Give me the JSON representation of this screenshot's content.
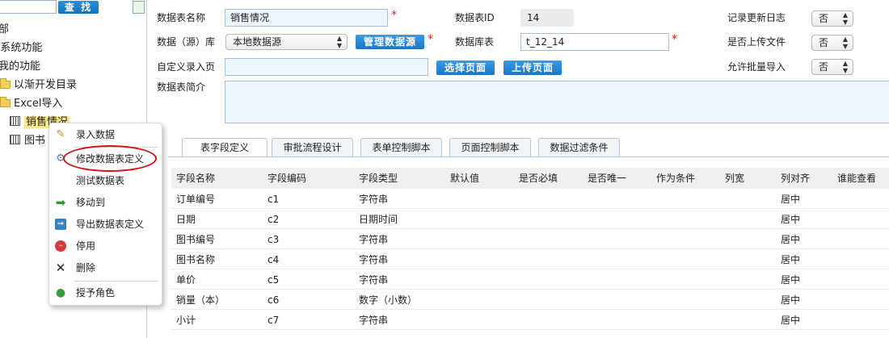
{
  "sidebar": {
    "search_placeholder": "",
    "search_button": "查 找",
    "nodes": [
      "部",
      "/系统功能",
      "我的功能",
      "以渐开发目录",
      "Excel导入",
      "销售情况",
      "图书"
    ]
  },
  "context_menu": {
    "items": [
      "录入数据",
      "修改数据表定义",
      "测试数据表",
      "移动到",
      "导出数据表定义",
      "停用",
      "删除",
      "授予角色"
    ]
  },
  "form": {
    "table_name_label": "数据表名称",
    "table_name_value": "销售情况",
    "table_id_label": "数据表ID",
    "table_id_value": "14",
    "log_label": "记录更新日志",
    "log_value": "否",
    "datasource_label": "数据（源）库",
    "datasource_value": "本地数据源",
    "manage_ds_button": "管理数据源",
    "db_table_label": "数据库表",
    "db_table_value": "t_12_14",
    "upload_file_label": "是否上传文件",
    "upload_file_value": "否",
    "custom_page_label": "自定义录入页",
    "custom_page_value": "",
    "select_page_button": "选择页面",
    "upload_page_button": "上传页面",
    "batch_import_label": "允许批量导入",
    "batch_import_value": "否",
    "desc_label": "数据表简介",
    "desc_value": "",
    "required_mark": "*"
  },
  "tabs": [
    "表字段定义",
    "审批流程设计",
    "表单控制脚本",
    "页面控制脚本",
    "数据过滤条件"
  ],
  "grid": {
    "columns": [
      "字段名称",
      "字段编码",
      "字段类型",
      "默认值",
      "是否必填",
      "是否唯一",
      "作为条件",
      "列宽",
      "列对齐",
      "谁能查看"
    ],
    "rows": [
      {
        "name": "订单编号",
        "code": "c1",
        "type": "字符串",
        "align": "居中"
      },
      {
        "name": "日期",
        "code": "c2",
        "type": "日期时间",
        "align": "居中"
      },
      {
        "name": "图书编号",
        "code": "c3",
        "type": "字符串",
        "align": "居中"
      },
      {
        "name": "图书名称",
        "code": "c4",
        "type": "字符串",
        "align": "居中"
      },
      {
        "name": "单价",
        "code": "c5",
        "type": "字符串",
        "align": "居中"
      },
      {
        "name": "销量（本）",
        "code": "c6",
        "type": "数字（小数）",
        "align": "居中"
      },
      {
        "name": "小计",
        "code": "c7",
        "type": "字符串",
        "align": "居中"
      }
    ]
  }
}
